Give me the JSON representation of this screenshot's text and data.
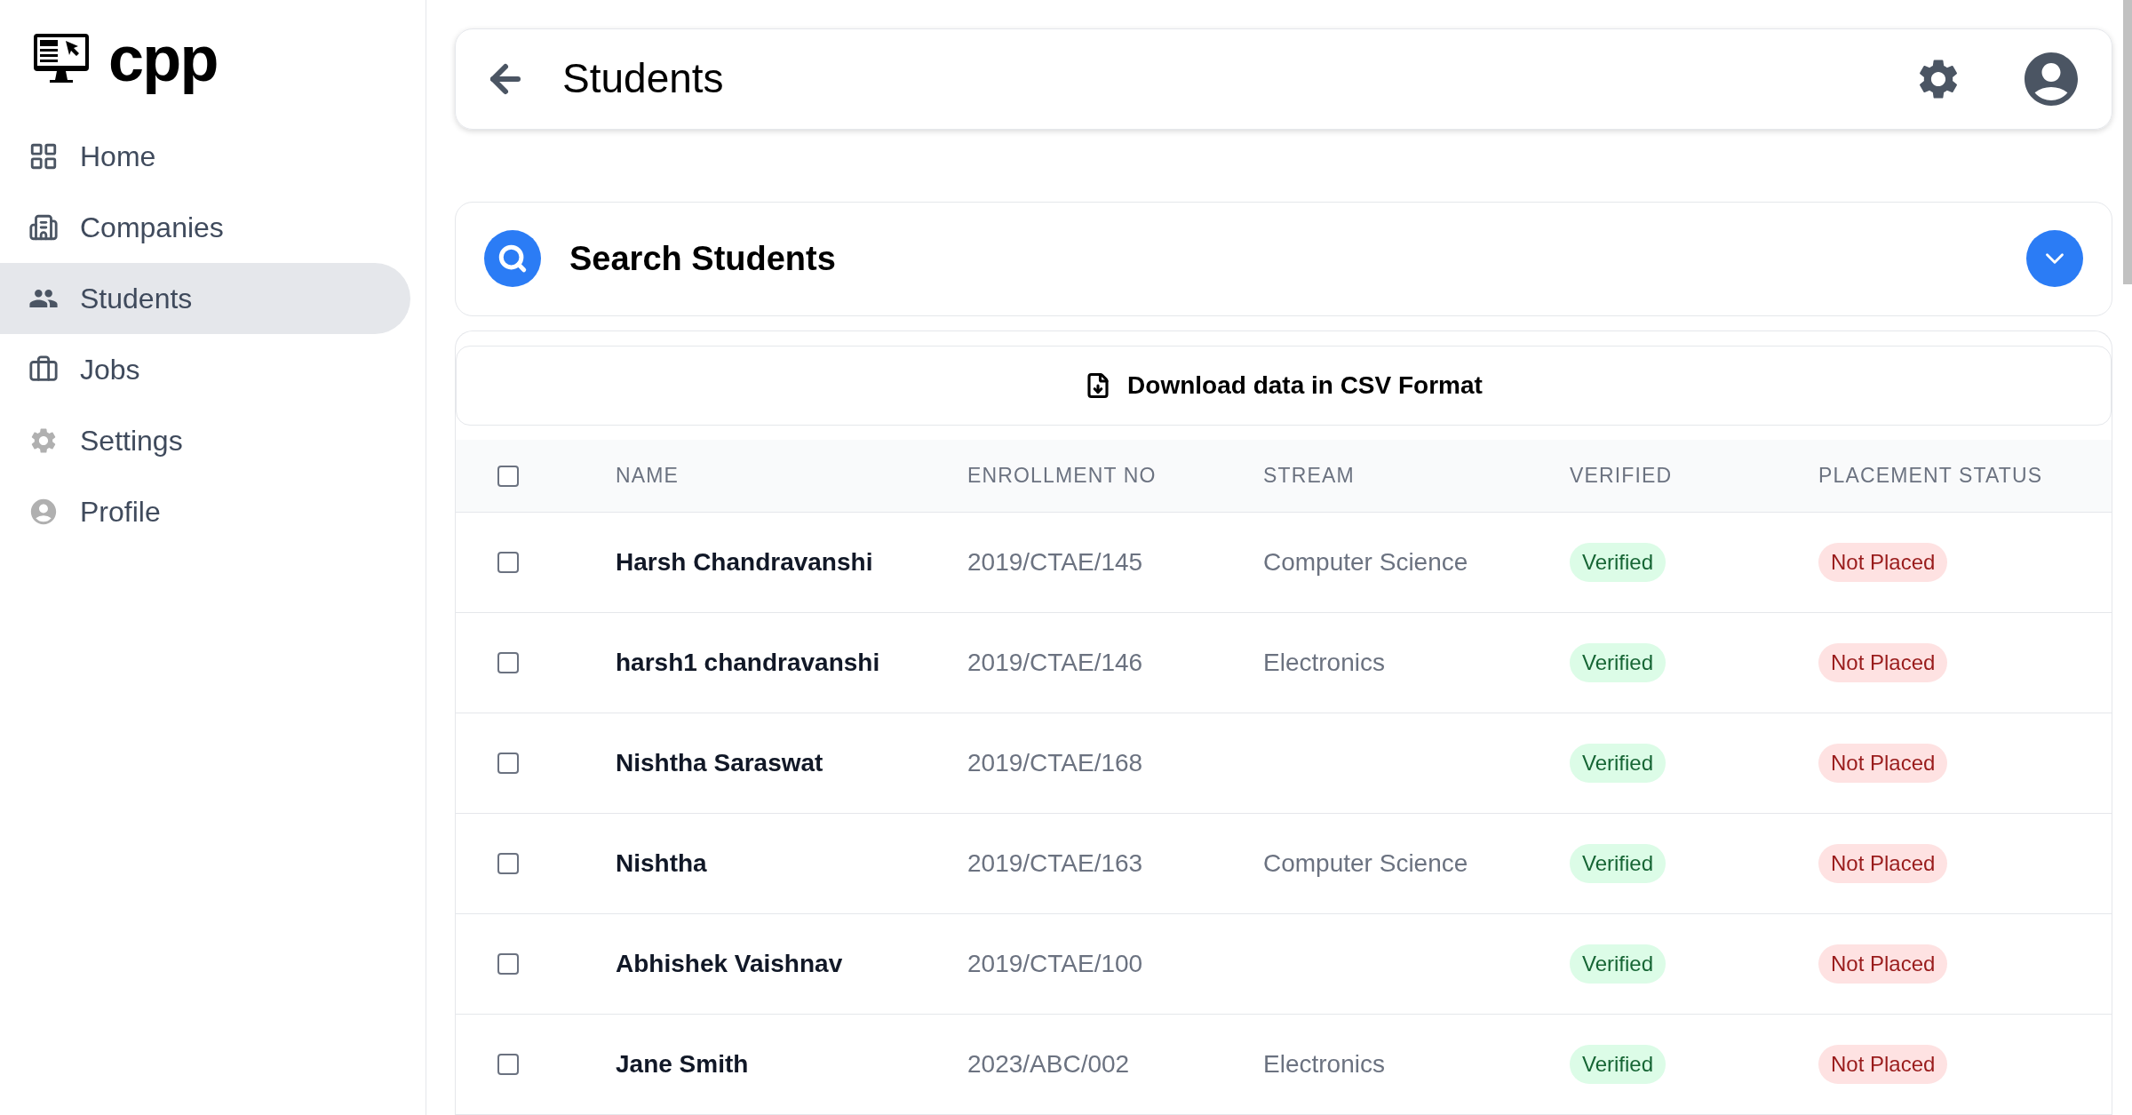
{
  "sidebar": {
    "logo": "cpp",
    "items": [
      {
        "label": "Home",
        "kind": "home",
        "selected": false
      },
      {
        "label": "Companies",
        "kind": "companies",
        "selected": false
      },
      {
        "label": "Students",
        "kind": "students",
        "selected": true
      },
      {
        "label": "Jobs",
        "kind": "jobs",
        "selected": false
      },
      {
        "label": "Settings",
        "kind": "settings",
        "selected": false
      },
      {
        "label": "Profile",
        "kind": "profile",
        "selected": false
      }
    ]
  },
  "header": {
    "title": "Students"
  },
  "search_panel": {
    "title": "Search Students",
    "expanded": false
  },
  "download_button": "Download data in CSV Format",
  "table": {
    "select_all_checked": false,
    "columns": [
      "NAME",
      "ENROLLMENT NO",
      "STREAM",
      "VERIFIED",
      "PLACEMENT STATUS"
    ],
    "rows": [
      {
        "checked": false,
        "name": "Harsh Chandravanshi",
        "enrollment": "2019/CTAE/145",
        "stream": "Computer Science",
        "verified": {
          "text": "Verified",
          "kind": "success"
        },
        "placement": {
          "text": "Not Placed",
          "kind": "danger"
        }
      },
      {
        "checked": false,
        "name": "harsh1 chandravanshi",
        "enrollment": "2019/CTAE/146",
        "stream": "Electronics",
        "verified": {
          "text": "Verified",
          "kind": "success"
        },
        "placement": {
          "text": "Not Placed",
          "kind": "danger"
        }
      },
      {
        "checked": false,
        "name": "Nishtha Saraswat",
        "enrollment": "2019/CTAE/168",
        "verified": {
          "text": "Verified",
          "kind": "success"
        },
        "placement": {
          "text": "Not Placed",
          "kind": "danger"
        }
      },
      {
        "checked": false,
        "name": "Nishtha",
        "enrollment": "2019/CTAE/163",
        "stream": "Computer Science",
        "verified": {
          "text": "Verified",
          "kind": "success"
        },
        "placement": {
          "text": "Not Placed",
          "kind": "danger"
        }
      },
      {
        "checked": false,
        "name": "Abhishek Vaishnav",
        "enrollment": "2019/CTAE/100",
        "verified": {
          "text": "Verified",
          "kind": "success"
        },
        "placement": {
          "text": "Not Placed",
          "kind": "danger"
        }
      },
      {
        "checked": false,
        "name": "Jane Smith",
        "enrollment": "2023/ABC/002",
        "stream": "Electronics",
        "verified": {
          "text": "Verified",
          "kind": "success"
        },
        "placement": {
          "text": "Not Placed",
          "kind": "danger"
        }
      }
    ]
  }
}
